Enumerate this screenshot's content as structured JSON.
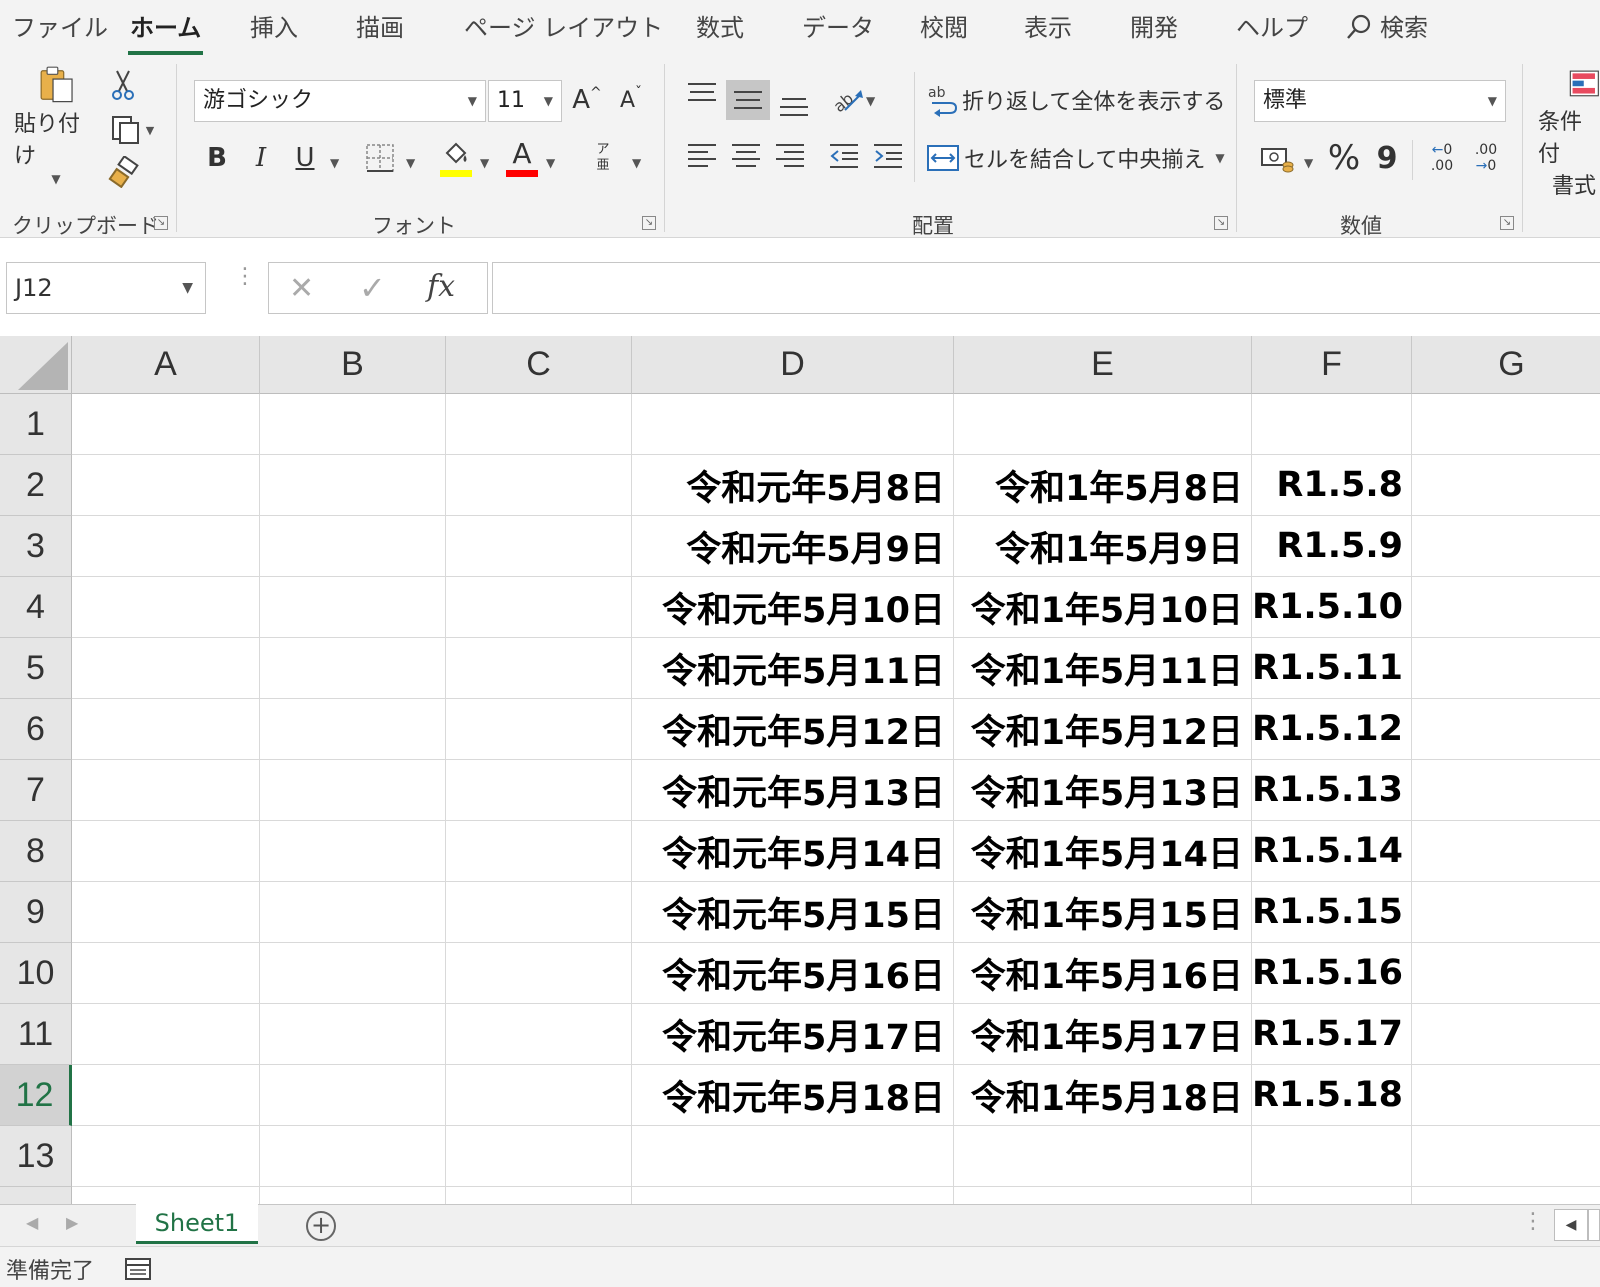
{
  "menu": {
    "tabs": [
      "ファイル",
      "ホーム",
      "挿入",
      "描画",
      "ページ レイアウト",
      "数式",
      "データ",
      "校閲",
      "表示",
      "開発",
      "ヘルプ"
    ],
    "active": "ホーム",
    "search": "検索"
  },
  "ribbon": {
    "clipboard": {
      "label": "クリップボード",
      "paste_label": "貼り付け"
    },
    "font": {
      "label": "フォント",
      "font_name": "游ゴシック",
      "font_size": "11",
      "bold": "B",
      "italic": "I",
      "underline": "U",
      "font_color_glyph": "A",
      "grow_glyph": "A",
      "shrink_glyph": "A",
      "phonetic_glyph": "ア亜"
    },
    "alignment": {
      "label": "配置",
      "wrap_text": "折り返して全体を表示する",
      "merge_center": "セルを結合して中央揃え",
      "wrap_icon_text": "ab"
    },
    "number": {
      "label": "数値",
      "format": "標準",
      "percent": "%",
      "comma": "9",
      "inc_decimal": ".00",
      "dec_decimal": ".00"
    },
    "styles": {
      "cond_format_label_1": "条件付",
      "cond_format_label_2": "書式"
    }
  },
  "formula_bar": {
    "name_box": "J12",
    "formula": "",
    "fx_label": "fx"
  },
  "columns": [
    "A",
    "B",
    "C",
    "D",
    "E",
    "F",
    "G"
  ],
  "rows": [
    "1",
    "2",
    "3",
    "4",
    "5",
    "6",
    "7",
    "8",
    "9",
    "10",
    "11",
    "12",
    "13"
  ],
  "active_row": "12",
  "cells": [
    {
      "row": "2",
      "D": "令和元年5月8日",
      "E": "令和1年5月8日",
      "F": "R1.5.8"
    },
    {
      "row": "3",
      "D": "令和元年5月9日",
      "E": "令和1年5月9日",
      "F": "R1.5.9"
    },
    {
      "row": "4",
      "D": "令和元年5月10日",
      "E": "令和1年5月10日",
      "F": "R1.5.10"
    },
    {
      "row": "5",
      "D": "令和元年5月11日",
      "E": "令和1年5月11日",
      "F": "R1.5.11"
    },
    {
      "row": "6",
      "D": "令和元年5月12日",
      "E": "令和1年5月12日",
      "F": "R1.5.12"
    },
    {
      "row": "7",
      "D": "令和元年5月13日",
      "E": "令和1年5月13日",
      "F": "R1.5.13"
    },
    {
      "row": "8",
      "D": "令和元年5月14日",
      "E": "令和1年5月14日",
      "F": "R1.5.14"
    },
    {
      "row": "9",
      "D": "令和元年5月15日",
      "E": "令和1年5月15日",
      "F": "R1.5.15"
    },
    {
      "row": "10",
      "D": "令和元年5月16日",
      "E": "令和1年5月16日",
      "F": "R1.5.16"
    },
    {
      "row": "11",
      "D": "令和元年5月17日",
      "E": "令和1年5月17日",
      "F": "R1.5.17"
    },
    {
      "row": "12",
      "D": "令和元年5月18日",
      "E": "令和1年5月18日",
      "F": "R1.5.18"
    }
  ],
  "sheets": [
    "Sheet1"
  ],
  "status": "準備完了",
  "colors": {
    "accent": "#217346",
    "fill_color": "#ffff00",
    "font_color": "#ff0000"
  }
}
